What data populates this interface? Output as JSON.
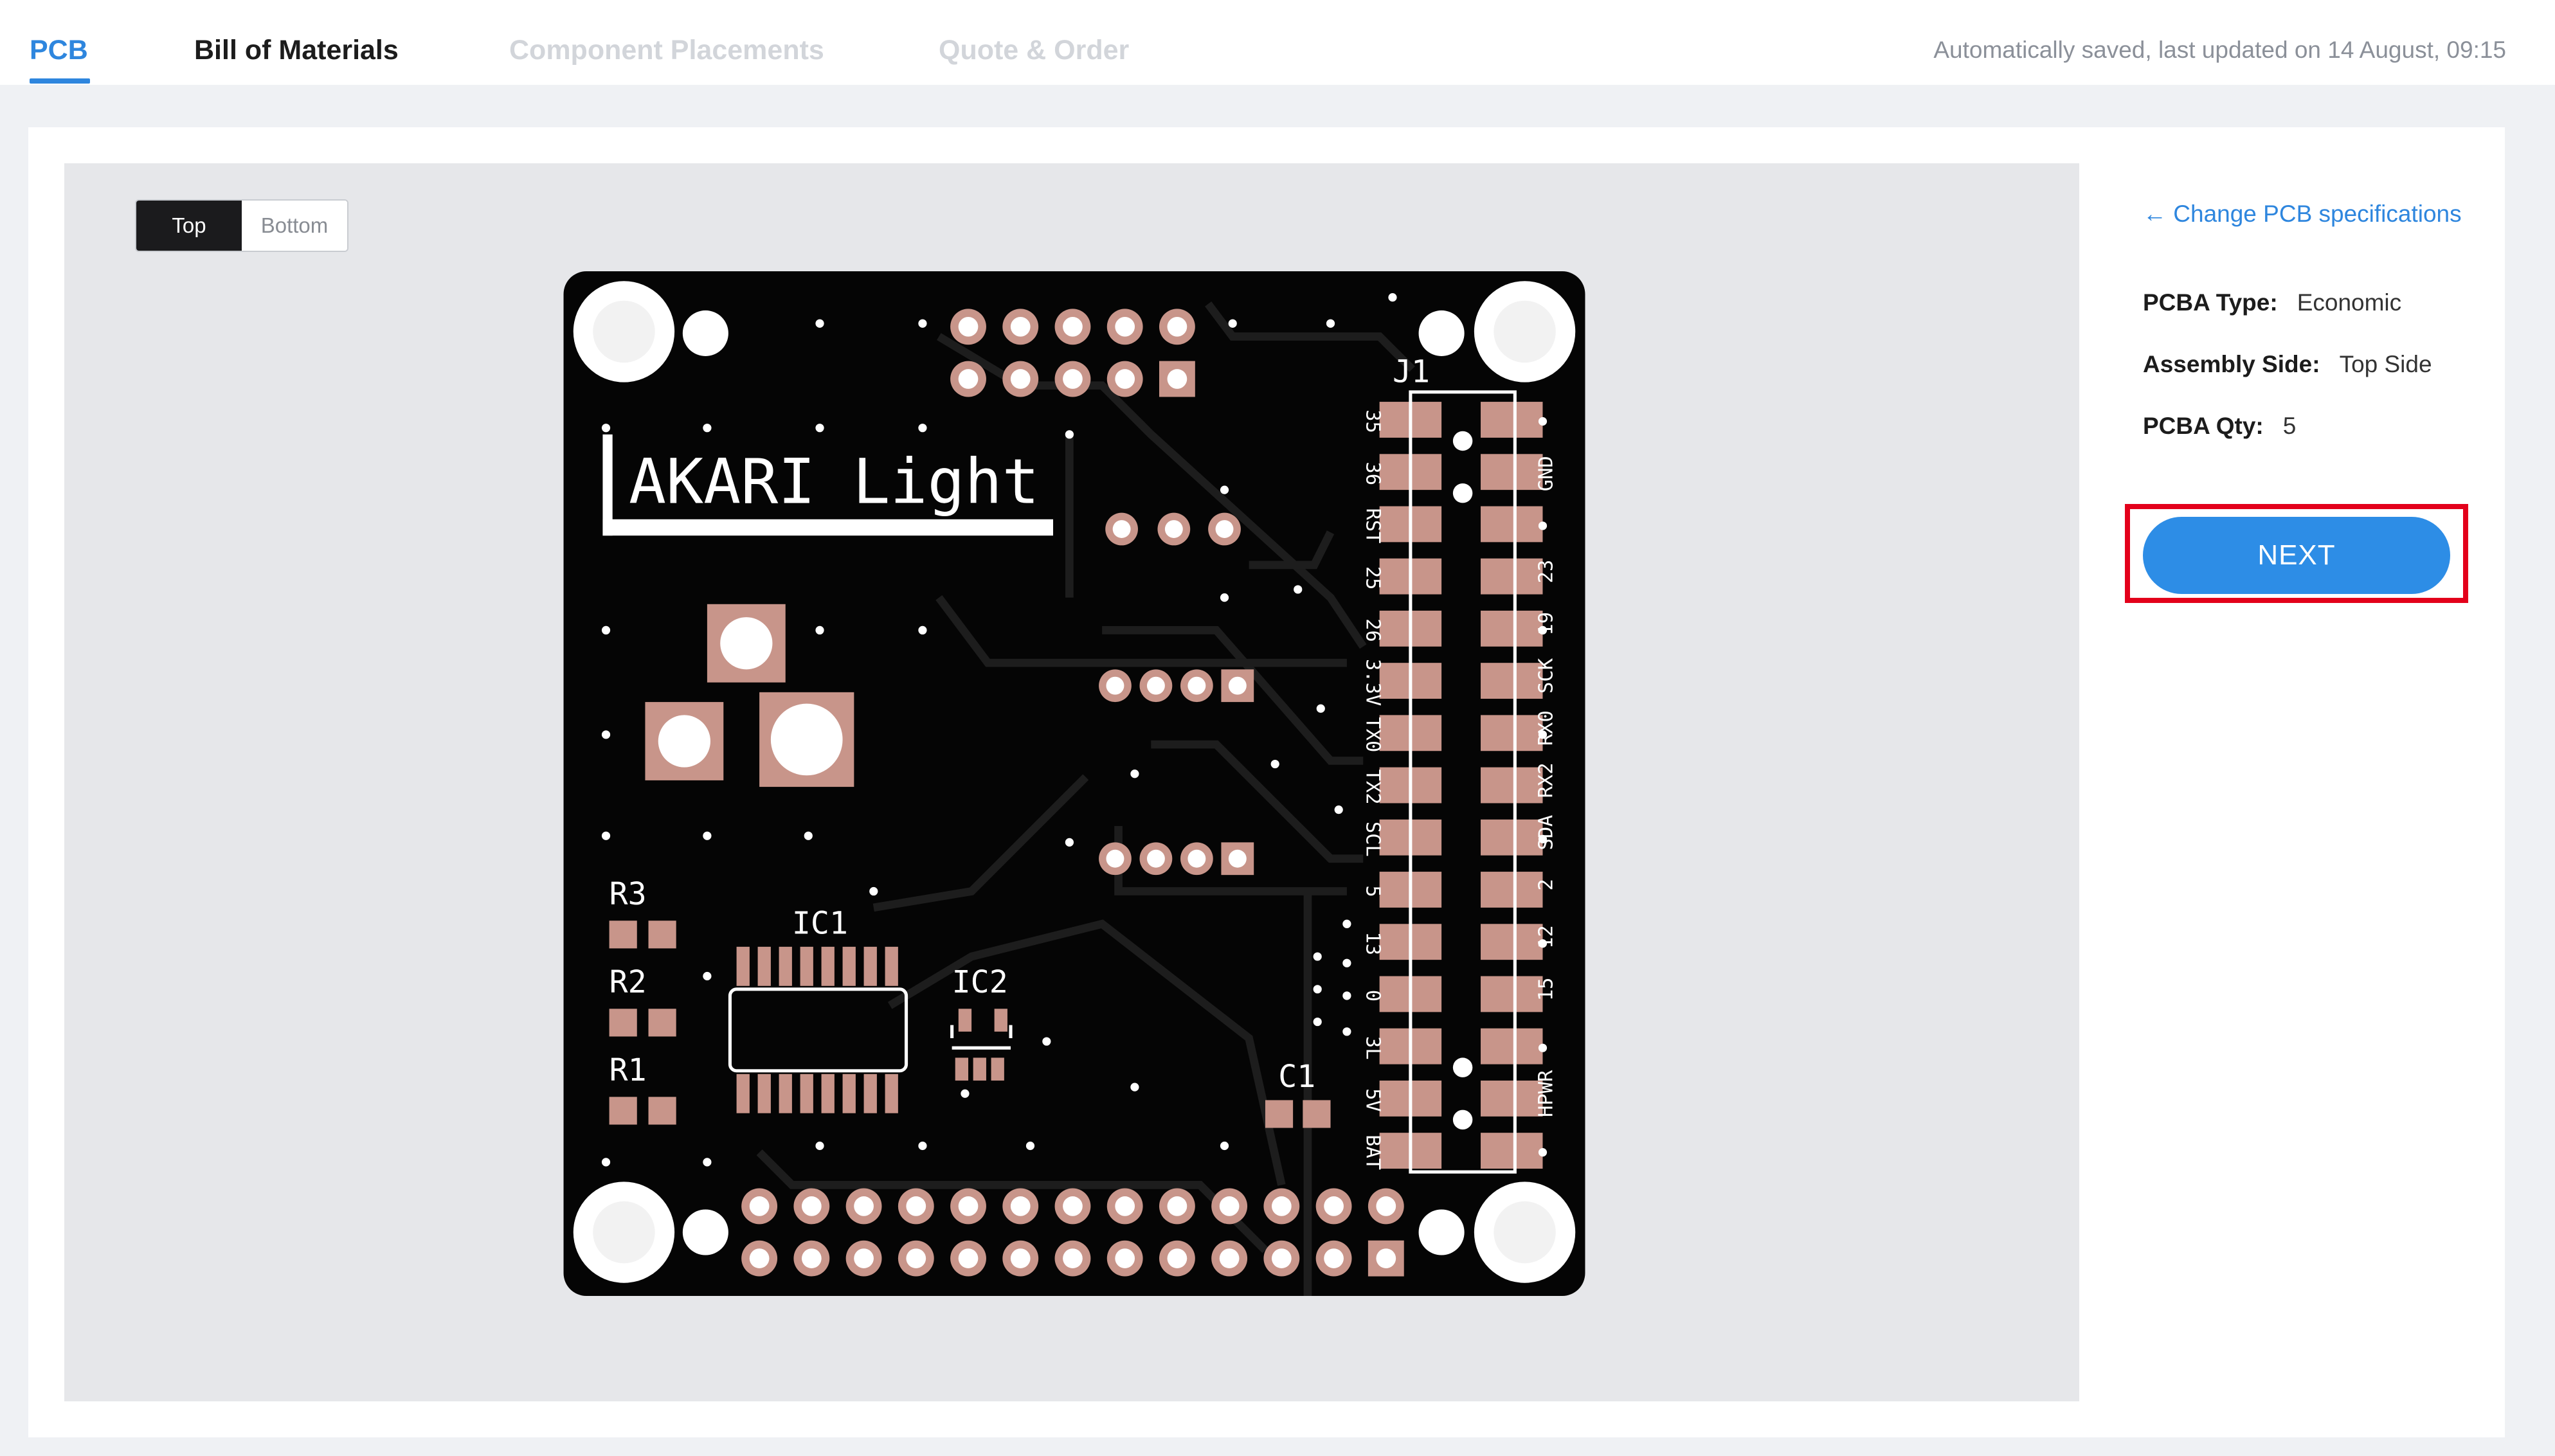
{
  "tabs": {
    "pcb": "PCB",
    "bom": "Bill of Materials",
    "component_placements": "Component Placements",
    "quote_order": "Quote & Order"
  },
  "save_status": "Automatically saved, last updated on 14 August, 09:15",
  "viewer": {
    "toggle": {
      "top": "Top",
      "bottom": "Bottom",
      "selected": "Top"
    },
    "board": {
      "title": "AKARI Light",
      "refs": {
        "j1": "J1",
        "ic1": "IC1",
        "ic2": "IC2",
        "c1": "C1",
        "r1": "R1",
        "r2": "R2",
        "r3": "R3"
      },
      "pins_left": [
        "35",
        "36",
        "RST",
        "25",
        "26",
        "3.3V",
        "TX0",
        "TX2",
        "SCL",
        "5",
        "13",
        "0",
        "3L",
        "5V",
        "BAT"
      ],
      "pins_right": [
        "GND",
        "23",
        "19",
        "SCK",
        "RX0",
        "RX2",
        "SDA",
        "2",
        "12",
        "15",
        "HPWR"
      ]
    }
  },
  "panel": {
    "change_link": "← Change PCB specifications",
    "pcba_type_label": "PCBA Type:",
    "pcba_type_value": "Economic",
    "assembly_side_label": "Assembly Side:",
    "assembly_side_value": "Top Side",
    "pcba_qty_label": "PCBA Qty:",
    "pcba_qty_value": "5",
    "next": "NEXT"
  },
  "colors": {
    "accent": "#2e86de",
    "button": "#2d8de6",
    "highlight": "#e3001b",
    "board": "#050505",
    "pad": "#c8958a"
  }
}
